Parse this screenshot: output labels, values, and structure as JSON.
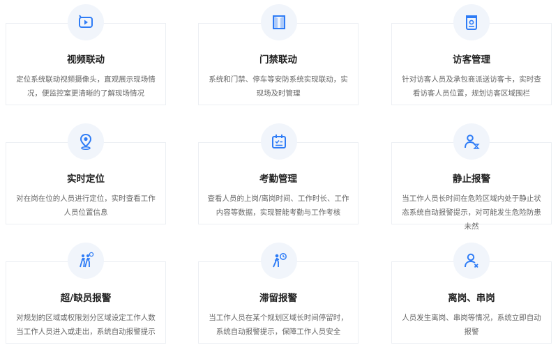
{
  "features": [
    {
      "title": "视频联动",
      "desc": "定位系统联动视频摄像头，直观展示现场情况，便监控室更清晰的了解现场情况",
      "icon": "video-icon"
    },
    {
      "title": "门禁联动",
      "desc": "系统和门禁、停车等安防系统实现联动，实现场及时管理",
      "icon": "door-icon"
    },
    {
      "title": "访客管理",
      "desc": "针对访客人员及承包商派送访客卡，实时查看访客人员位置，规划访客区域围栏",
      "icon": "visitor-card-icon"
    },
    {
      "title": "实时定位",
      "desc": "对在岗在位的人员进行定位，实时查看工作人员位置信息",
      "icon": "location-pin-icon"
    },
    {
      "title": "考勤管理",
      "desc": "查看人员的上岗/离岗时间、工作时长、工作内容等数据，实现智能考勤与工作考核",
      "icon": "calendar-icon"
    },
    {
      "title": "静止报警",
      "desc": "当工作人员长时间在危险区域内处于静止状态系统自动报警提示，对可能发生危险防患未然",
      "icon": "static-person-icon"
    },
    {
      "title": "超/缺员报警",
      "desc": "对规划的区域或权限划分区域设定工作人数当工作人员进入或走出，系统自动报警提示",
      "icon": "people-walking-icon"
    },
    {
      "title": "滞留报警",
      "desc": "当工作人员在某个规划区域长时间停留时，系统自动报警提示，保障工作人员安全",
      "icon": "person-clock-icon"
    },
    {
      "title": "离岗、串岗",
      "desc": "人员发生离岗、串岗等情况，系统立即自动报警",
      "icon": "person-x-icon"
    }
  ],
  "colors": {
    "accent": "#2e7cf6",
    "icon_bg": "#f1f5fb",
    "title": "#222222",
    "desc": "#666666"
  }
}
